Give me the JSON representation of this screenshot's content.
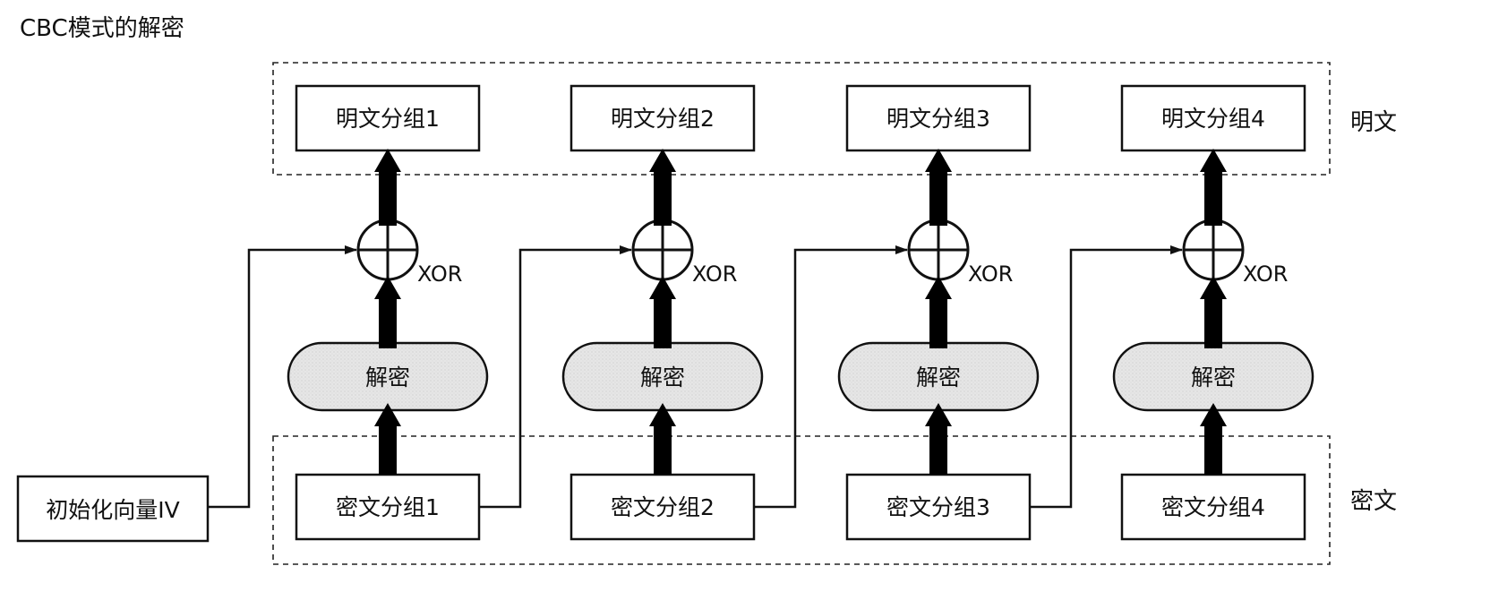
{
  "title": "CBC模式的解密",
  "regions": {
    "plaintext_label": "明文",
    "ciphertext_label": "密文"
  },
  "iv_label": "初始化向量IV",
  "xor_label": "XOR",
  "decrypt_label": "解密",
  "plaintext_blocks": [
    "明文分组1",
    "明文分组2",
    "明文分组3",
    "明文分组4"
  ],
  "ciphertext_blocks": [
    "密文分组1",
    "密文分组2",
    "密文分组3",
    "密文分组4"
  ],
  "colors": {
    "stroke": "#111111",
    "decrypt_fill": "#e4e4e4",
    "background": "#ffffff"
  }
}
